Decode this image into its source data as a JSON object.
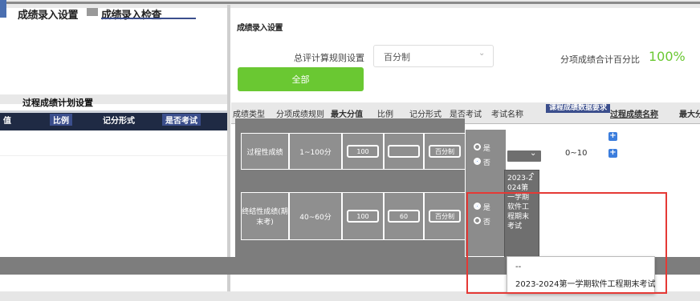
{
  "colors": {
    "accent_green": "#6ac832",
    "header_navy": "#1f2a44",
    "highlight_red": "#e53935",
    "blue": "#3b7ddd"
  },
  "top": {
    "tab1": "成绩录入设置",
    "tab2": "成绩录入检查",
    "panel_title": "成绩录入设置"
  },
  "settings": {
    "rule_label": "总评计算规则设置",
    "rule_value": "百分制",
    "sum_label": "分项成绩合计百分比",
    "sum_value": "100%",
    "all_button": "全部"
  },
  "left": {
    "title": "过程成绩计划设置",
    "headers": [
      "值",
      "比例",
      "记分形式",
      "是否考试"
    ]
  },
  "table": {
    "headers": [
      "成绩类型",
      "分项成绩规则",
      "最大分值",
      "比例",
      "记分形式",
      "是否考试",
      "考试名称",
      "课程成绩数据要求",
      "过程成绩名称",
      "最大分"
    ],
    "rows": [
      {
        "type": "过程性成绩",
        "rule": "1~100分",
        "max": "100",
        "ratio": "",
        "mode": "百分制",
        "exam_yes": "是",
        "exam_no": "否",
        "range": "0~10"
      },
      {
        "type": "终结性成绩(期末考)",
        "rule": "40~60分",
        "max": "100",
        "ratio": "60",
        "mode": "百分制",
        "exam_yes": "是",
        "exam_no": "否",
        "exam_name": "2023-2024第一学期软件工程期末考试"
      }
    ]
  },
  "dropdown": {
    "items": [
      "--",
      "2023-2024第一学期软件工程期末考试"
    ]
  }
}
